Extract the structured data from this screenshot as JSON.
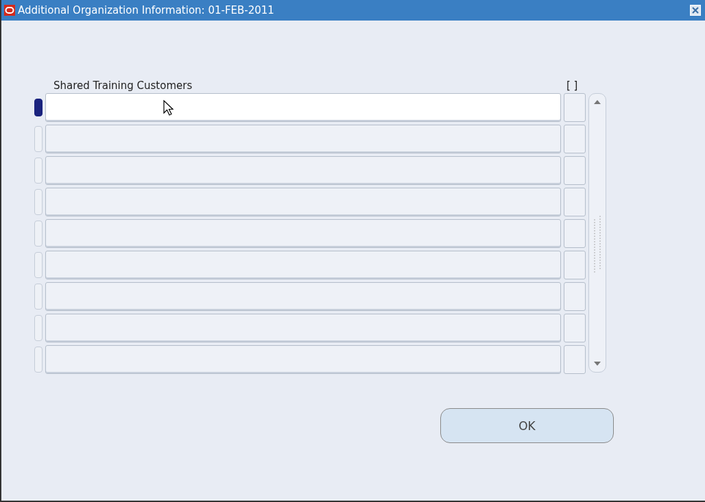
{
  "window": {
    "title": "Additional Organization Information: 01-FEB-2011"
  },
  "table": {
    "column_label": "Shared Training Customers",
    "column_2_label": "[ ]",
    "rows": [
      {
        "selected": true
      },
      {
        "selected": false
      },
      {
        "selected": false
      },
      {
        "selected": false
      },
      {
        "selected": false
      },
      {
        "selected": false
      },
      {
        "selected": false
      },
      {
        "selected": false
      },
      {
        "selected": false
      }
    ]
  },
  "buttons": [
    {
      "label": "OK"
    }
  ]
}
